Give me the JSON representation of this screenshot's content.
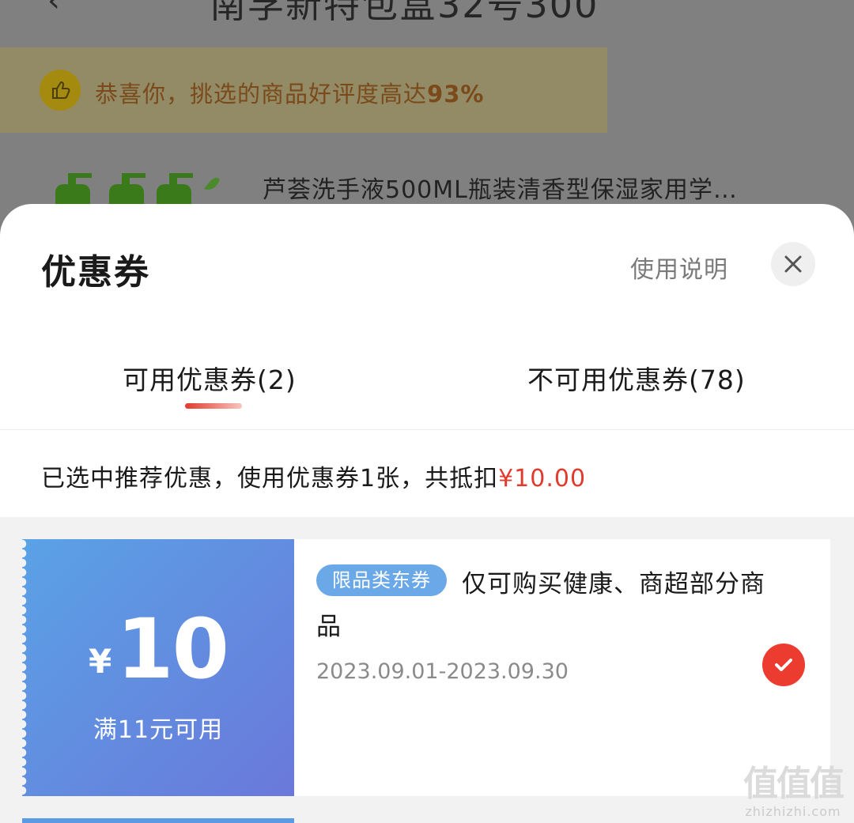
{
  "background": {
    "back_glyph": "‹",
    "title": "南孚新特包盒32号300",
    "banner_text_prefix": "恭喜你，挑选的商品好评度高达",
    "banner_percent": "93%",
    "product_name": "芦荟洗手液500ML瓶装清香型保湿家用学…"
  },
  "sheet": {
    "title": "优惠券",
    "help_label": "使用说明",
    "close_icon": "close-icon"
  },
  "tabs": [
    {
      "label": "可用优惠券(2)",
      "active": true
    },
    {
      "label": "不可用优惠券(78)",
      "active": false
    }
  ],
  "summary": {
    "text": "已选中推荐优惠，使用优惠券1张，共抵扣",
    "amount": "¥10.00"
  },
  "coupons": [
    {
      "currency": "¥",
      "value": "10",
      "condition": "满11元可用",
      "tag": "限品类东券",
      "description": "仅可购买健康、商超部分商品",
      "date_range": "2023.09.01-2023.09.30",
      "selected": true
    }
  ],
  "watermark": {
    "logo": "值值值",
    "site": "zhizhizhi.com"
  },
  "colors": {
    "accent_red": "#e23a2d",
    "coupon_blue_start": "#5aa2e6",
    "coupon_blue_end": "#6a78da",
    "tag_blue": "#6aa8e8"
  }
}
